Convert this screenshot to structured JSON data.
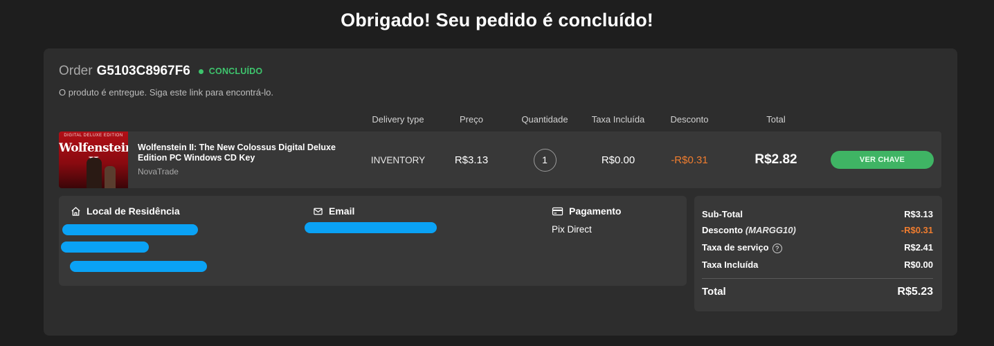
{
  "page": {
    "title": "Obrigado! Seu pedido é concluído!"
  },
  "order": {
    "prefix": "Order",
    "id": "G5103C8967F6",
    "status": "CONCLUÍDO",
    "note": "O produto é entregue. Siga este link para encontrá-lo."
  },
  "columns": {
    "delivery": "Delivery type",
    "price": "Preço",
    "quantity": "Quantidade",
    "tax": "Taxa Incluída",
    "discount": "Desconto",
    "total": "Total"
  },
  "product": {
    "thumb_top": "DIGITAL DELUXE EDITION",
    "thumb_logo": "Wolfenstein II",
    "name": "Wolfenstein II: The New Colossus Digital Deluxe Edition PC Windows CD Key",
    "seller": "NovaTrade",
    "delivery": "INVENTORY",
    "price": "R$3.13",
    "quantity": "1",
    "tax": "R$0.00",
    "discount": "-R$0.31",
    "total": "R$2.82",
    "button": "VER CHAVE"
  },
  "info": {
    "residence_label": "Local de Residência",
    "email_label": "Email",
    "payment_label": "Pagamento",
    "payment_value": "Pix Direct"
  },
  "summary": {
    "subtotal_label": "Sub-Total",
    "subtotal": "R$3.13",
    "discount_label": "Desconto",
    "discount_code": "(MARGG10)",
    "discount": "-R$0.31",
    "service_label": "Taxa de serviço",
    "service": "R$2.41",
    "tax_label": "Taxa Incluída",
    "tax": "R$0.00",
    "total_label": "Total",
    "total": "R$5.23"
  },
  "colors": {
    "accent_green": "#3ec46d",
    "discount_orange": "#f07d2f",
    "redaction_blue": "#0aa2f5"
  },
  "icons": {
    "residence": "home-icon",
    "email": "envelope-icon",
    "payment": "credit-card-icon",
    "service_help": "question-circle-icon"
  }
}
